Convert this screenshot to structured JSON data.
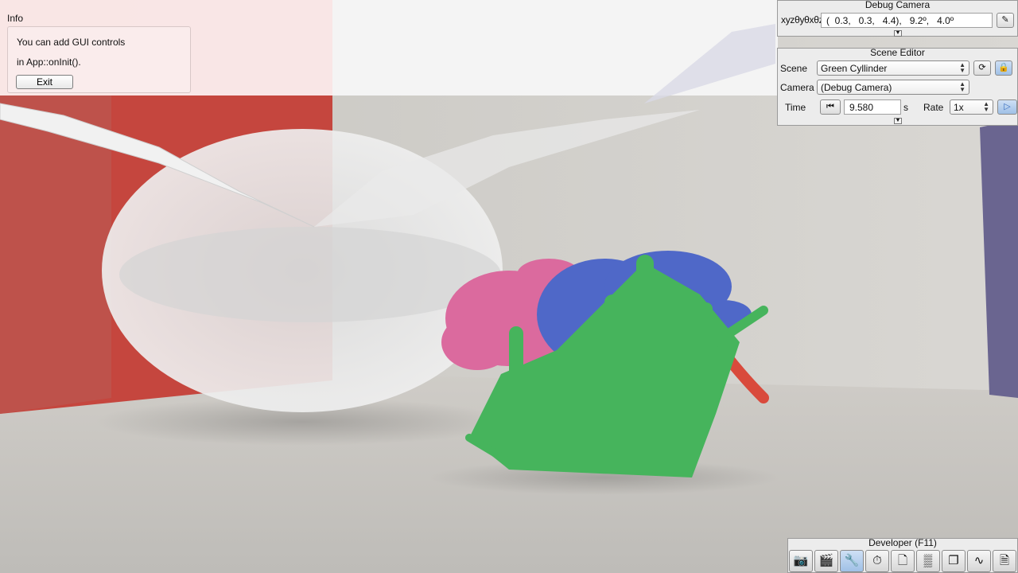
{
  "info": {
    "title": "Info",
    "line1": "You can add GUI controls",
    "line2": "in App::onInit().",
    "exit_label": "Exit"
  },
  "debug_camera": {
    "title": "Debug Camera",
    "label": "xyzθyθxθz",
    "value": "(  0.3,   0.3,   4.4),   9.2º,   4.0º",
    "copy_icon": "pencil-copy-icon"
  },
  "scene_editor": {
    "title": "Scene Editor",
    "scene_label": "Scene",
    "scene_value": "Green Cyllinder",
    "camera_label": "Camera",
    "camera_value": "(Debug Camera)",
    "time_label": "Time",
    "time_value": "9.580",
    "time_unit": "s",
    "rate_label": "Rate",
    "rate_value": "1x"
  },
  "developer": {
    "title": "Developer (F11)",
    "icons": [
      "camera-icon",
      "clapperboard-icon",
      "tools-icon",
      "clock-icon",
      "new-window-icon",
      "terminal-icon",
      "windows-icon",
      "profiler-icon",
      "document-icon"
    ]
  },
  "colors": {
    "red_wall": "#c5463e",
    "purple_wall": "#6a6590",
    "green_plant": "#46b45c",
    "blue_plant": "#4f68c8",
    "pink_plant": "#db6a9e"
  }
}
